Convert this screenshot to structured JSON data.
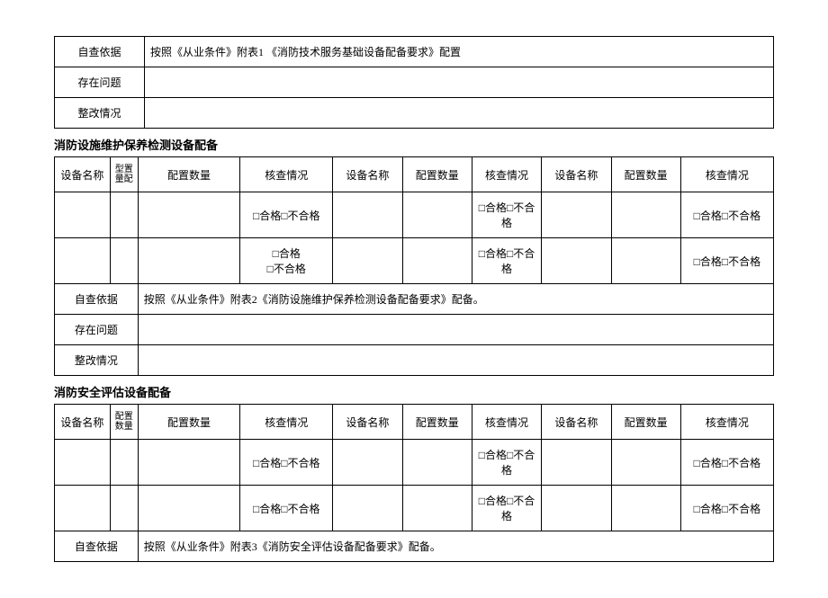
{
  "top": {
    "basis_label": "自查依据",
    "basis_content": "按照《从业条件》附表1 《消防技术服务基础设备配备要求》配置",
    "problem_label": "存在问题",
    "problem_content": "",
    "rectify_label": "整改情况",
    "rectify_content": ""
  },
  "section2": {
    "title": "消防设施维护保养检测设备配备",
    "headers": {
      "name": "设备名称",
      "model_qty": "置量配",
      "type": "型",
      "qty": "配置数量",
      "check": "核查情况"
    },
    "check_combined": "□合格□不合格",
    "check_two_line_a": "□合格",
    "check_two_line_b": "□不合格",
    "check_wrap": "□合格□不合格",
    "basis_label": "自查依据",
    "basis_content": "按照《从业条件》附表2《消防设施维护保养检测设备配备要求》配备。",
    "problem_label": "存在问题",
    "problem_content": "",
    "rectify_label": "整改情况",
    "rectify_content": ""
  },
  "section3": {
    "title": "消防安全评估设备配备",
    "headers": {
      "name": "设备名称",
      "config_qty": "配置数量",
      "qty": "配置数量",
      "check": "核查情况"
    },
    "check_combined": "□合格□不合格",
    "check_wrap": "□合格□不合格",
    "basis_label": "自查依据",
    "basis_content": "按照《从业条件》附表3《消防安全评估设备配备要求》配备。"
  }
}
